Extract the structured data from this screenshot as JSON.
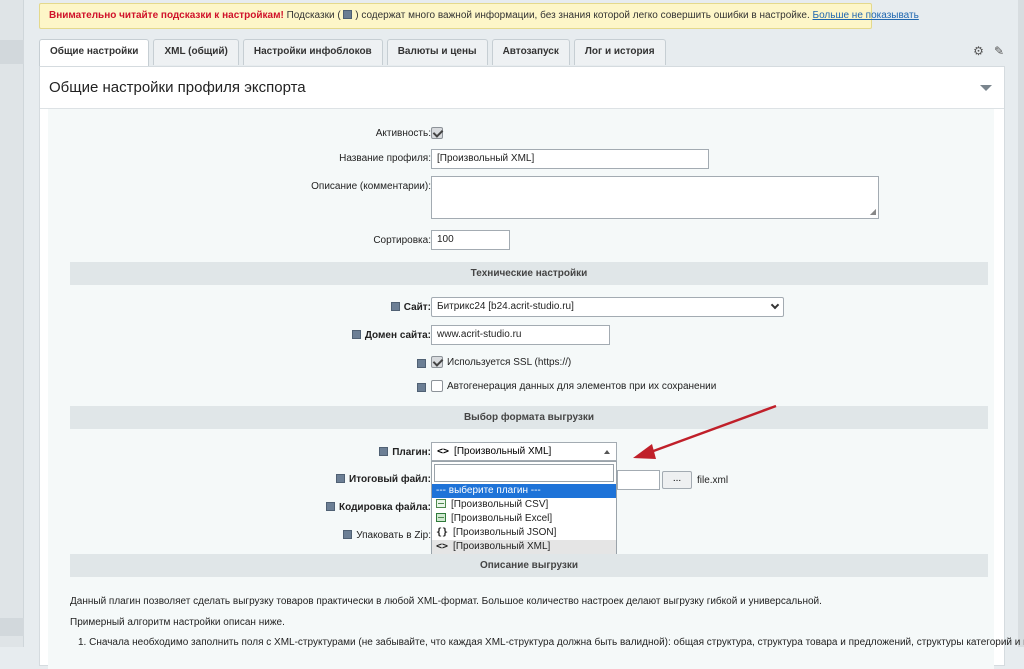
{
  "notice": {
    "warning": "Внимательно читайте подсказки к настройкам!",
    "text_before": " Подсказки (",
    "text_after": ") содержат много важной информации, без знания которой легко совершить ошибки в настройке.",
    "link": "Больше не показывать"
  },
  "tabs": [
    "Общие настройки",
    "XML (общий)",
    "Настройки инфоблоков",
    "Валюты и цены",
    "Автозапуск",
    "Лог и история"
  ],
  "panel_title": "Общие настройки профиля экспорта",
  "form": {
    "activity_label": "Активность:",
    "profile_name_label": "Название профиля:",
    "profile_name_value": "[Произвольный XML]",
    "description_label": "Описание (комментарии):",
    "sort_label": "Сортировка:",
    "sort_value": "100"
  },
  "tech": {
    "header": "Технические настройки",
    "site_label": "Сайт:",
    "site_value": "Битрикс24 [b24.acrit-studio.ru]",
    "domain_label": "Домен сайта:",
    "domain_value": "www.acrit-studio.ru",
    "ssl_label": "Используется SSL (https://)",
    "autogen_label": "Автогенерация данных для элементов при их сохранении"
  },
  "format": {
    "header": "Выбор формата выгрузки",
    "plugin_label": "Плагин:",
    "plugin_value": "[Произвольный XML]",
    "output_file_label": "Итоговый файл:",
    "browse_button": "...",
    "file_ext": "file.xml",
    "encoding_label": "Кодировка файла:",
    "zip_label": "Упаковать в Zip:",
    "dropdown": {
      "placeholder": "--- выберите плагин ---",
      "csv": "[Произвольный CSV]",
      "excel": "[Произвольный Excel]",
      "json": "[Произвольный JSON]",
      "xml": "[Произвольный XML]"
    }
  },
  "desc": {
    "header": "Описание выгрузки",
    "p1": "Данный плагин позволяет сделать выгрузку товаров практически в любой XML-формат. Большое количество настроек делают выгрузку гибкой и универсальной.",
    "p2": "Примерный алгоритм настройки описан ниже.",
    "p3": "1. Сначала необходимо заполнить поля с XML-структурами (не забывайте, что каждая XML-структура должна быть валидной): общая структура, структура товара и предложений, структуры категорий и валют,"
  },
  "colors": {
    "arrow": "#c0202a",
    "highlight": "#1e73d8",
    "warning": "#d0122a"
  }
}
